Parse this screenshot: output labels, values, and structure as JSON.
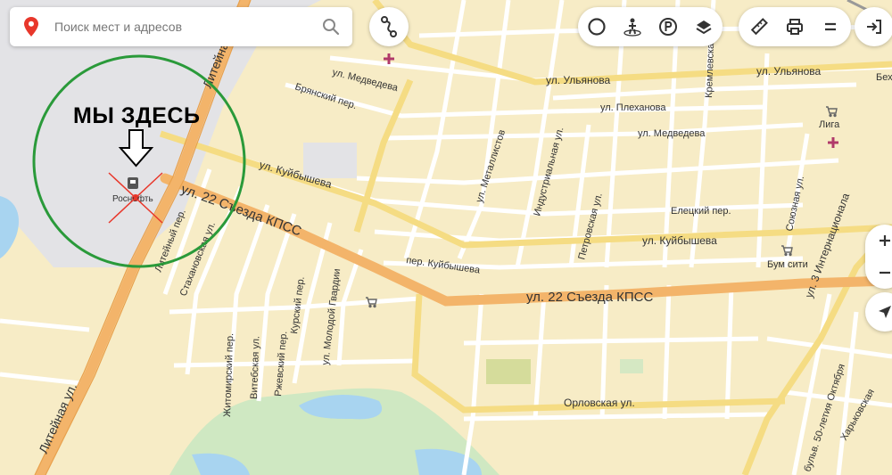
{
  "search": {
    "placeholder": "Поиск мест и адресов"
  },
  "annotation": {
    "text": "МЫ ЗДЕСЬ"
  },
  "icons": {
    "search_pin": "map-pin-icon",
    "search_button": "magnifier-icon",
    "route": "route-icon",
    "traffic": "traffic-icon",
    "panorama": "panorama-icon",
    "parking": "parking-icon",
    "layers": "layers-icon",
    "ruler": "ruler-icon",
    "print": "print-icon",
    "menu": "menu-icon",
    "login": "login-icon",
    "zoom_in": "plus-icon",
    "zoom_out": "minus-icon",
    "geolocate": "geolocate-icon"
  },
  "colors": {
    "accent_red": "#e8372b",
    "circle_green": "#2a9a3a",
    "main_road": "#f3b46a",
    "poi_pink": "#b03a6a"
  },
  "map": {
    "streets": [
      "ул. Медведева",
      "Брянский пер.",
      "ул. Ульянова",
      "ул. Плеханова",
      "ул. Медведева",
      "ул. Куйбышева",
      "ул. 22 Съезда КПСС",
      "ул. Металлистов",
      "Индустриальная ул.",
      "Кремлевская",
      "Лига",
      "Петровская ул.",
      "Елецкий пер.",
      "ул. Куйбышева",
      "Союзная ул.",
      "ул. 3 Интернационала",
      "Литейный пер.",
      "Стахановская ул.",
      "Курский пер.",
      "ул. Молодой Гвардии",
      "пер. Куйбышева",
      "ул. 22 Съезда КПСС",
      "Бум сити",
      "Житомирский пер.",
      "Витебская ул.",
      "Ржевский пер.",
      "Орловская ул.",
      "Литейная ул.",
      "Литейная",
      "бульв. 50-летия Октября",
      "Харьковская",
      "Беха",
      "Роснефть"
    ]
  }
}
